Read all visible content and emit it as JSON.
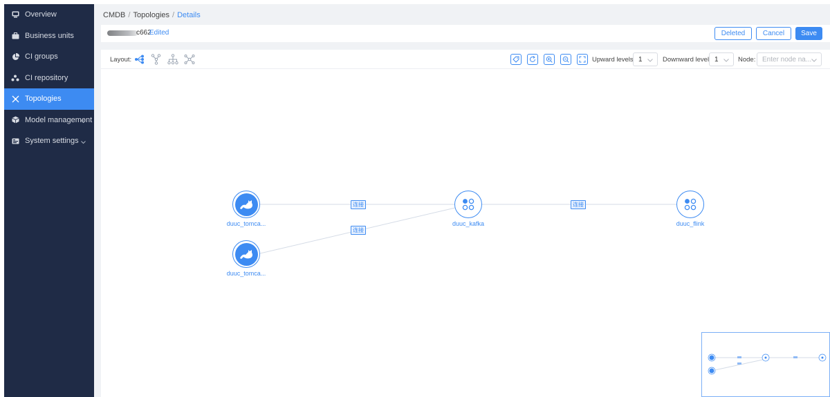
{
  "sidebar": {
    "items": [
      {
        "label": "Overview",
        "icon": "monitor-icon",
        "active": false,
        "expandable": false
      },
      {
        "label": "Business units",
        "icon": "briefcase-icon",
        "active": false,
        "expandable": false
      },
      {
        "label": "CI groups",
        "icon": "pie-chart-icon",
        "active": false,
        "expandable": false
      },
      {
        "label": "CI repository",
        "icon": "cluster-icon",
        "active": false,
        "expandable": false
      },
      {
        "label": "Topologies",
        "icon": "topology-icon",
        "active": true,
        "expandable": false
      },
      {
        "label": "Model management",
        "icon": "cube-icon",
        "active": false,
        "expandable": true
      },
      {
        "label": "System settings",
        "icon": "settings-panel-icon",
        "active": false,
        "expandable": true
      }
    ]
  },
  "breadcrumb": {
    "items": [
      "CMDB",
      "Topologies",
      "Details"
    ],
    "separator": "/"
  },
  "titlebar": {
    "name_suffix": "c662",
    "status": "Edited"
  },
  "actions": {
    "deleted": "Deleted",
    "cancel": "Cancel",
    "save": "Save"
  },
  "toolbar": {
    "layout_label": "Layout:",
    "layouts": [
      "dagre-lr-layout-icon",
      "tree-layout-icon",
      "hierarchy-layout-icon",
      "force-layout-icon"
    ],
    "tools": [
      "tag-icon",
      "refresh-icon",
      "zoom-in-icon",
      "zoom-out-icon",
      "fit-view-icon"
    ],
    "upward_label": "Upward levels:",
    "upward_value": "1",
    "downward_label": "Downward levels:",
    "downward_value": "1",
    "node_label": "Node:",
    "node_placeholder": "Enter node na..."
  },
  "graph": {
    "nodes": [
      {
        "id": "t1",
        "label": "duuc_tomca...",
        "icon": "tomcat-icon"
      },
      {
        "id": "t2",
        "label": "duuc_tomca...",
        "icon": "tomcat-icon"
      },
      {
        "id": "k",
        "label": "duuc_kafka",
        "icon": "kafka-icon"
      },
      {
        "id": "f",
        "label": "duuc_flink",
        "icon": "flink-icon"
      }
    ],
    "edges": [
      {
        "from": "t1",
        "to": "k",
        "label": "连接"
      },
      {
        "from": "t2",
        "to": "k",
        "label": "连接"
      },
      {
        "from": "k",
        "to": "f",
        "label": "连接"
      }
    ]
  },
  "colors": {
    "accent": "#3d8bf2",
    "sidebar_bg": "#1f2b46",
    "page_bg": "#f0f2f5"
  }
}
